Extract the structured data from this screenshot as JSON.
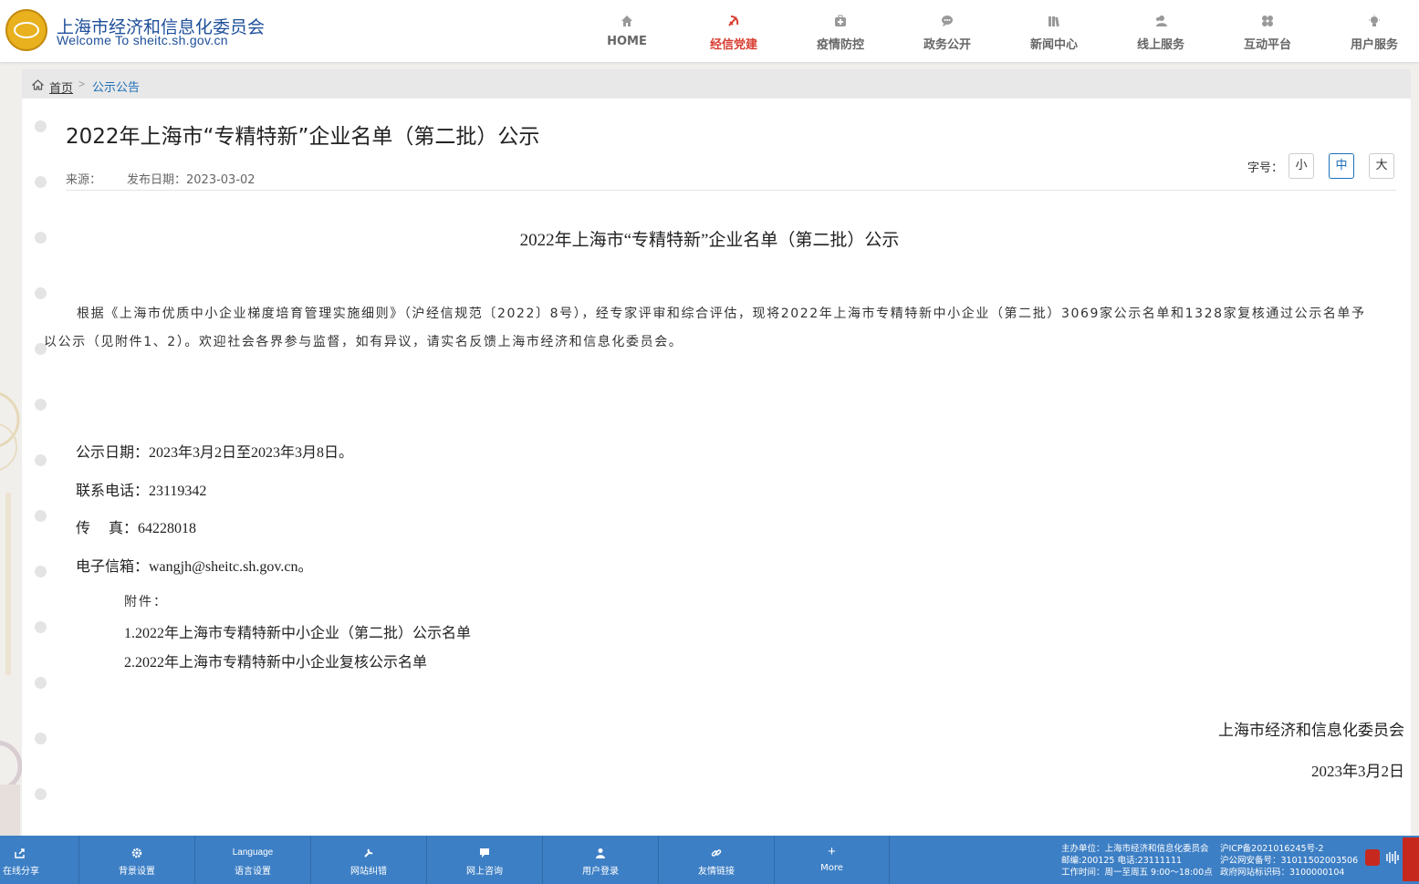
{
  "header": {
    "site_name": "上海市经济和信息化委员会",
    "site_sub": "Welcome To sheitc.sh.gov.cn",
    "nav": [
      {
        "label": "HOME",
        "icon": "home-icon",
        "active": false
      },
      {
        "label": "经信党建",
        "icon": "party-emblem-icon",
        "active": true
      },
      {
        "label": "疫情防控",
        "icon": "medical-kit-icon",
        "active": false
      },
      {
        "label": "政务公开",
        "icon": "chat-bubble-icon",
        "active": false
      },
      {
        "label": "新闻中心",
        "icon": "books-icon",
        "active": false
      },
      {
        "label": "线上服务",
        "icon": "users-icon",
        "active": false
      },
      {
        "label": "互动平台",
        "icon": "clover-icon",
        "active": false
      },
      {
        "label": "用户服务",
        "icon": "lightbulb-icon",
        "active": false
      }
    ]
  },
  "breadcrumb": {
    "home": "首页",
    "separator": ">",
    "current": "公示公告"
  },
  "article": {
    "title": "2022年上海市“专精特新”企业名单（第二批）公示",
    "source_label": "来源：",
    "date_label": "发布日期：2023-03-02",
    "font_size": {
      "label": "字号：",
      "small": "小",
      "medium": "中",
      "large": "大",
      "selected": "中"
    },
    "heading": "2022年上海市“专精特新”企业名单（第二批）公示",
    "body": "根据《上海市优质中小企业梯度培育管理实施细则》（沪经信规范〔2022〕8号），经专家评审和综合评估，现将2022年上海市专精特新中小企业（第二批）3069家公示名单和1328家复核通过公示名单予以公示（见附件1、2）。欢迎社会各界参与监督，如有异议，请实名反馈上海市经济和信息化委员会。",
    "period": "公示日期：2023年3月2日至2023年3月8日。",
    "phone": "联系电话：23119342",
    "fax": "传　 真：64228018",
    "email": "电子信箱：wangjh@sheitc.sh.gov.cn。",
    "attach_label": "附件：",
    "attachments": [
      "1.2022年上海市专精特新中小企业（第二批）公示名单",
      "2.2022年上海市专精特新中小企业复核公示名单"
    ],
    "signature": "上海市经济和信息化委员会",
    "sign_date": "2023年3月2日"
  },
  "footer": {
    "items": [
      {
        "top": "",
        "label": "在线分享",
        "icon": "share-icon"
      },
      {
        "top": "",
        "label": "背景设置",
        "icon": "gear-icon"
      },
      {
        "top": "Language",
        "label": "语言设置",
        "icon": ""
      },
      {
        "top": "",
        "label": "网站纠错",
        "icon": "wrench-icon"
      },
      {
        "top": "",
        "label": "网上咨询",
        "icon": "message-icon"
      },
      {
        "top": "",
        "label": "用户登录",
        "icon": "user-icon"
      },
      {
        "top": "",
        "label": "友情链接",
        "icon": "link-icon"
      },
      {
        "top": "+",
        "label": "More",
        "icon": ""
      }
    ],
    "info_left": [
      "主办单位：上海市经济和信息化委员会",
      "邮编:200125 电话:23111111",
      "工作时间：周一至周五 9:00～18:00点"
    ],
    "info_right": [
      "沪ICP备2021016245号-2",
      "沪公网安备号：31011502003506",
      "政府网站标识码：3100000104"
    ]
  },
  "colors": {
    "accent": "#3d7fc5",
    "active_nav": "#d83b2e",
    "brand_blue": "#1d4f9a"
  }
}
